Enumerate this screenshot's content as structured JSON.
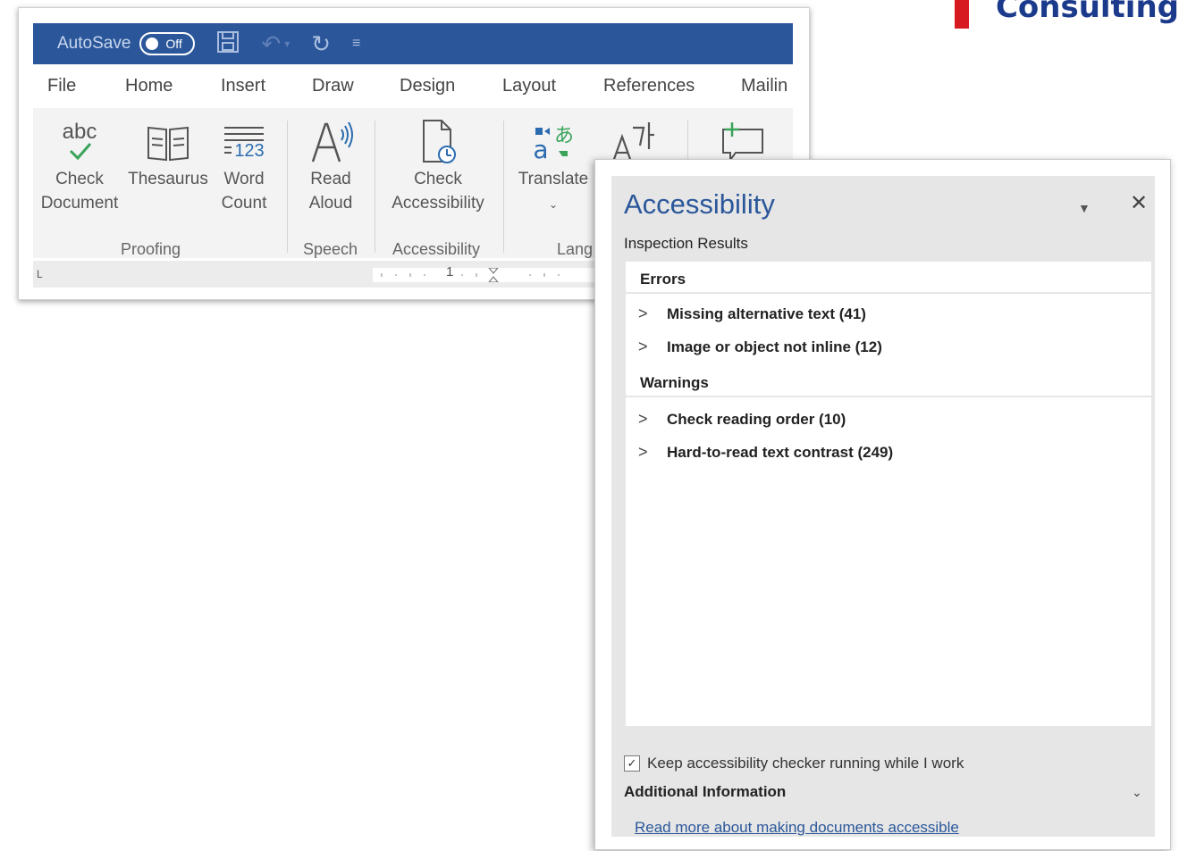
{
  "brand": {
    "text": "Consulting",
    "color": "#d71920"
  },
  "word": {
    "titlebar": {
      "autosave_label": "AutoSave",
      "toggle_text": "Off",
      "accent": "#2b579a",
      "icons": [
        "save-icon",
        "undo-icon",
        "redo-icon",
        "customize-toolbar-icon"
      ]
    },
    "tabs": [
      "File",
      "Home",
      "Insert",
      "Draw",
      "Design",
      "Layout",
      "References",
      "Mailin"
    ],
    "ribbon": {
      "check_document": {
        "line1": "Check",
        "line2": "Document",
        "icon_text": "abc"
      },
      "thesaurus": {
        "label": "Thesaurus"
      },
      "word_count": {
        "line1": "Word",
        "line2": "Count",
        "icon_text": "123"
      },
      "read_aloud": {
        "line1": "Read",
        "line2": "Aloud"
      },
      "check_accessibility": {
        "line1": "Check",
        "line2": "Accessibility"
      },
      "translate": {
        "label": "Translate"
      },
      "groups": {
        "proofing": "Proofing",
        "speech": "Speech",
        "accessibility": "Accessibility",
        "language": "Lang"
      }
    },
    "ruler": {
      "number": "1"
    }
  },
  "pane": {
    "title": "Accessibility",
    "subtitle": "Inspection Results",
    "errors_label": "Errors",
    "errors": [
      "Missing alternative text (41)",
      "Image or object not inline (12)"
    ],
    "warnings_label": "Warnings",
    "warnings": [
      "Check reading order (10)",
      "Hard-to-read text contrast (249)"
    ],
    "keep_running_label": "Keep accessibility checker running while I work",
    "keep_running_checked": true,
    "additional_info_label": "Additional Information",
    "read_more_link": "Read more about making documents accessible"
  }
}
